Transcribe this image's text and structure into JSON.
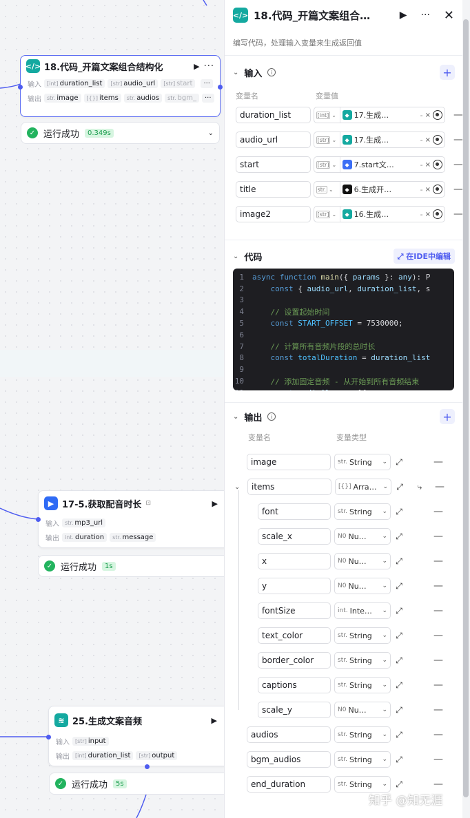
{
  "canvas": {
    "node18": {
      "title": "18.代码_开篇文案组合结构化",
      "in_label": "输入",
      "out_label": "输出",
      "inputs": [
        {
          "type": "[int]",
          "name": "duration_list"
        },
        {
          "type": "[str]",
          "name": "audio_url"
        },
        {
          "type": "[str]",
          "name": "start"
        }
      ],
      "outputs": [
        {
          "type": "str.",
          "name": "image"
        },
        {
          "type": "[{}]",
          "name": "items"
        },
        {
          "type": "str.",
          "name": "audios"
        },
        {
          "type": "str.",
          "name": "bgm_"
        }
      ],
      "status": "运行成功",
      "time": "0.349s"
    },
    "node17": {
      "title": "17-5.获取配音时长",
      "in_label": "输入",
      "out_label": "输出",
      "inputs": [
        {
          "type": "str.",
          "name": "mp3_url"
        }
      ],
      "outputs": [
        {
          "type": "int.",
          "name": "duration"
        },
        {
          "type": "str.",
          "name": "message"
        }
      ],
      "status": "运行成功",
      "time": "1s"
    },
    "node25": {
      "title": "25.生成文案音频",
      "in_label": "输入",
      "out_label": "输出",
      "inputs": [
        {
          "type": "[str]",
          "name": "input"
        }
      ],
      "outputs": [
        {
          "type": "[int]",
          "name": "duration_list"
        },
        {
          "type": "[str]",
          "name": "output"
        }
      ],
      "status": "运行成功",
      "time": "5s"
    }
  },
  "panel": {
    "title": "18.代码_开篇文案组合…",
    "description": "编写代码，处理输入变量来生成返回值",
    "input_section": {
      "title": "输入",
      "col_name": "变量名",
      "col_value": "变量值",
      "rows": [
        {
          "name": "duration_list",
          "type": "[int]",
          "ref": "17.生成…",
          "ref_tail": "-",
          "ref_color": "#14a9a0"
        },
        {
          "name": "audio_url",
          "type": "[str]",
          "ref": "17.生成…",
          "ref_tail": "-",
          "ref_color": "#14a9a0"
        },
        {
          "name": "start",
          "type": "[str]",
          "ref": "7.start文…",
          "ref_tail": "-",
          "ref_color": "#3b6ef5"
        },
        {
          "name": "title",
          "type": "str.",
          "ref": "6.生成开…",
          "ref_tail": "-",
          "ref_color": "#111111"
        },
        {
          "name": "image2",
          "type": "[str]",
          "ref": "16.生成…",
          "ref_tail": "-",
          "ref_color": "#14a9a0"
        }
      ]
    },
    "code_section": {
      "title": "代码",
      "ide_label": "在IDE中编辑",
      "lines": [
        {
          "n": "1",
          "html": "<span class=\"kw\">async function</span> <span class=\"fn\">main</span>({ <span class=\"var\">params</span> }: <span class=\"var\">any</span>): P"
        },
        {
          "n": "2",
          "html": "    <span class=\"kw\">const</span> { <span class=\"var\">audio_url</span>, <span class=\"var\">duration_list</span>, s"
        },
        {
          "n": "3",
          "html": ""
        },
        {
          "n": "4",
          "html": "    <span class=\"cm\">// 设置起始时间</span>"
        },
        {
          "n": "5",
          "html": "    <span class=\"kw\">const</span> <span class=\"cn\">START_OFFSET</span> = <span class=\"ct\">7530000</span>;"
        },
        {
          "n": "6",
          "html": ""
        },
        {
          "n": "7",
          "html": "    <span class=\"cm\">// 计算所有音频片段的总时长</span>"
        },
        {
          "n": "8",
          "html": "    <span class=\"kw\">const</span> <span class=\"cn\">totalDuration</span> = <span class=\"var\">duration_list</span>"
        },
        {
          "n": "9",
          "html": ""
        },
        {
          "n": "10",
          "html": "    <span class=\"cm\">// 添加固定音频 - 从开始到所有音频结束</span>"
        },
        {
          "n": "11",
          "html": "    <span class=\"kw\">const</span> <span class=\"var\">audioAlarm</span> = [{"
        }
      ]
    },
    "output_section": {
      "title": "输出",
      "col_name": "变量名",
      "col_type": "变量类型",
      "rows": [
        {
          "name": "image",
          "pre": "str.",
          "type": "String",
          "level": 0
        },
        {
          "name": "items",
          "pre": "[{}]",
          "type": "Arra…",
          "level": 0,
          "parent": true
        },
        {
          "name": "font",
          "pre": "str.",
          "type": "String",
          "level": 1
        },
        {
          "name": "scale_x",
          "pre": "N0",
          "type": "Nu…",
          "level": 1
        },
        {
          "name": "x",
          "pre": "N0",
          "type": "Nu…",
          "level": 1
        },
        {
          "name": "y",
          "pre": "N0",
          "type": "Nu…",
          "level": 1
        },
        {
          "name": "fontSize",
          "pre": "int.",
          "type": "Inte…",
          "level": 1
        },
        {
          "name": "text_color",
          "pre": "str.",
          "type": "String",
          "level": 1
        },
        {
          "name": "border_color",
          "pre": "str.",
          "type": "String",
          "level": 1
        },
        {
          "name": "captions",
          "pre": "str.",
          "type": "String",
          "level": 1
        },
        {
          "name": "scale_y",
          "pre": "N0",
          "type": "Nu…",
          "level": 1
        },
        {
          "name": "audios",
          "pre": "str.",
          "type": "String",
          "level": 0
        },
        {
          "name": "bgm_audios",
          "pre": "str.",
          "type": "String",
          "level": 0
        },
        {
          "name": "end_duration",
          "pre": "str.",
          "type": "String",
          "level": 0
        }
      ]
    }
  },
  "watermark": "知乎 @知无涯",
  "colors": {
    "accent": "#4e5cf0",
    "success": "#22b35e",
    "code_icon": "#14a9a0",
    "audio_icon": "#2f6bf5"
  }
}
